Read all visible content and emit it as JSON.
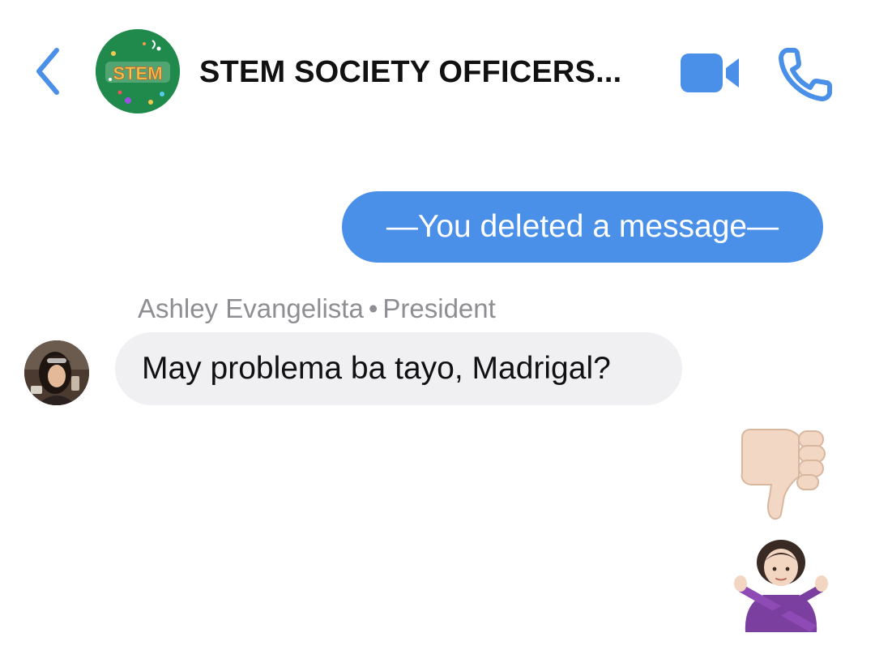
{
  "header": {
    "back_icon": "chevron-left-icon",
    "group_avatar_text": "STEM",
    "title": "STEM SOCIETY OFFICERS...",
    "video_icon": "video-camera-icon",
    "call_icon": "phone-icon",
    "accent_color": "#4a90e8"
  },
  "messages": [
    {
      "direction": "outgoing",
      "type": "text",
      "text": "—You deleted a message—",
      "bubble_color": "#4a90e8"
    },
    {
      "direction": "incoming",
      "type": "text",
      "sender": "Ashley Evangelista",
      "separator": "•",
      "role": "President",
      "text": "May problema ba tayo, Madrigal?",
      "bubble_color": "#f0f0f3"
    },
    {
      "direction": "outgoing",
      "type": "emoji",
      "emoji": "thumbs-down-light-skin-tone"
    },
    {
      "direction": "outgoing",
      "type": "emoji",
      "emoji": "woman-gesturing-no-light-skin-tone"
    }
  ]
}
